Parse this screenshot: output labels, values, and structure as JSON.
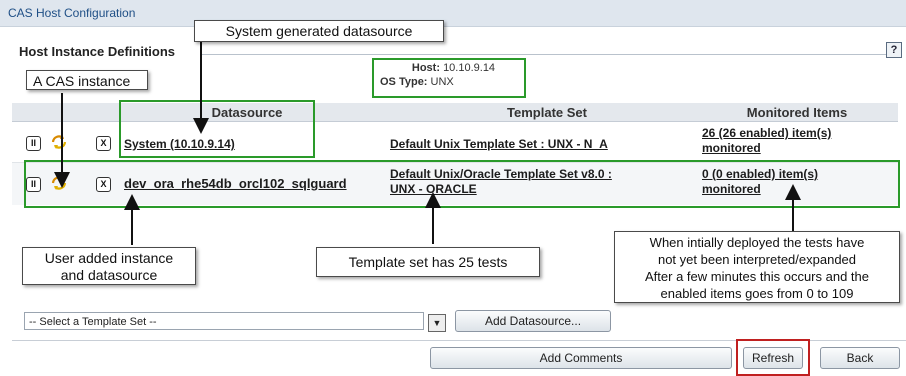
{
  "window": {
    "title": "CAS Host Configuration"
  },
  "section": {
    "title": "Host Instance Definitions",
    "help_glyph": "?"
  },
  "host": {
    "host_label": "Host:",
    "host_value": "10.10.9.14",
    "ostype_label": "OS Type:",
    "ostype_value": "UNX"
  },
  "table": {
    "columns": [
      "Datasource",
      "Template Set",
      "Monitored Items"
    ],
    "rows": [
      {
        "datasource": "System (10.10.9.14)",
        "template": "Default Unix Template Set : UNX - N_A",
        "monitored_line1": "26 (26 enabled) item(s)",
        "monitored_line2": "monitored"
      },
      {
        "datasource": "dev_ora_rhe54db_orcl102_sqlguard",
        "template_line1": "Default Unix/Oracle Template Set v8.0 :",
        "template_line2": "UNX - ORACLE",
        "monitored_line1": "0 (0 enabled) item(s)",
        "monitored_line2": "monitored"
      }
    ],
    "row_button_glyphs": {
      "pause": "II",
      "remove": "X"
    }
  },
  "callouts": {
    "system_generated": "System generated datasource",
    "cas_instance": "A CAS instance",
    "user_added_line1": "User added instance",
    "user_added_line2": "and datasource",
    "template_tests": "Template set has 25  tests",
    "deploy_line1": "When intially deployed the tests have",
    "deploy_line2": "not yet been interpreted/expanded",
    "deploy_line3": "After a few minutes this occurs and the",
    "deploy_line4": "enabled items goes from 0 to 109"
  },
  "controls": {
    "template_select": "-- Select a Template Set --",
    "select_arrow": "▼",
    "add_datasource": "Add Datasource...",
    "add_comments": "Add Comments",
    "refresh": "Refresh",
    "back": "Back"
  },
  "colors": {
    "highlight_green": "#2a9a2a",
    "highlight_red": "#c02020",
    "header_bg": "#e4e8ed",
    "title_text": "#1f4f86"
  }
}
